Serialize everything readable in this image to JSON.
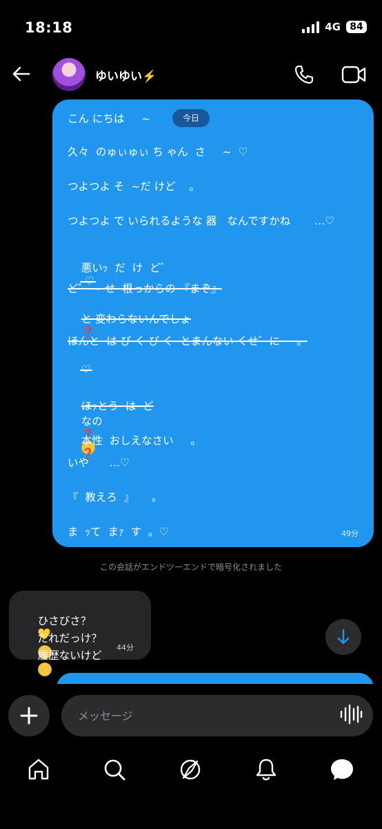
{
  "status": {
    "time": "18:18",
    "network": "4G",
    "battery": "84"
  },
  "header": {
    "contact_name": "ゆいゆい⚡️"
  },
  "conversation": {
    "date_pill": "今日",
    "sent_message": {
      "lines": [
        "こん にちは     ~",
        "久々  のゅぃゅぃ ち ゃん  さ     ~  ♡",
        "つよつよ そ  ~だ けど    。",
        "つよつよ で いられるような 器   なんですかね       …♡",
        "悪いｯ  だ  け  ど゛",
        "ど゛ ~ せ  根っからの 『まぞ』",
        "と 変わらないんでしょ",
        "ほんと  は び く び く  とまんない くせ゛に     。",
        "ほｯとう  は  ど",
        "なの",
        "本性  おしえなさい     。",
        "いや      …♡",
        "『  教えろ  』     。",
        "ま  ｯて  まｧ  す  。♡"
      ],
      "red_question": "❓",
      "time": "49分"
    },
    "encryption_notice": "この会話がエンドツーエンドで暗号化されました",
    "received_message": {
      "lines": [
        "ひさびさ？",
        "だれだっけ？",
        "履歴ないけど"
      ],
      "heart": "💛",
      "time": "44分"
    }
  },
  "composer": {
    "placeholder": "メッセージ"
  },
  "icons": {
    "back": "back-arrow-icon",
    "phone": "phone-icon",
    "video": "video-icon",
    "scroll": "arrow-down-icon",
    "plus": "plus-icon",
    "voice": "voice-wave-icon"
  },
  "tabs": [
    "home",
    "search",
    "explore",
    "notifications",
    "messages"
  ],
  "colors": {
    "sent_bubble": "#2196ee",
    "received_bubble": "#262628",
    "background": "#000000"
  }
}
